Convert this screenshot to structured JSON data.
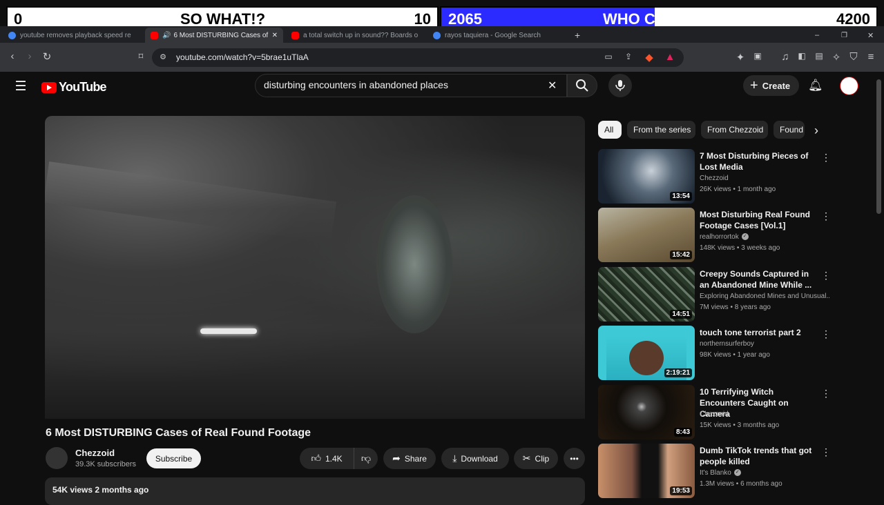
{
  "overlay": {
    "left_score": "0",
    "left_label": "SO WHAT!?",
    "left_count": "10",
    "right_score": "2065",
    "right_label": "WHO CARES!?",
    "right_count": "4200",
    "right_fill_fraction": 0.49,
    "accent": "#2b2bff"
  },
  "browser": {
    "tabs": [
      {
        "label": "youtube removes playback speed re",
        "favicon": "google-icon",
        "color": "#4285f4"
      },
      {
        "label": "6 Most DISTURBING Cases of",
        "favicon": "youtube-icon",
        "color": "#ff0000"
      },
      {
        "label": "a total switch up in sound?? Boards o",
        "favicon": "youtube-icon",
        "color": "#ff0000"
      },
      {
        "label": "rayos taquiera - Google Search",
        "favicon": "google-icon",
        "color": "#4285f4"
      }
    ],
    "url": "youtube.com/watch?v=5brae1uTlaA"
  },
  "youtube": {
    "logo": "YouTube",
    "search_value": "disturbing encounters in abandoned places",
    "create_label": "Create",
    "video_title": "6 Most DISTURBING Cases of Real Found Footage",
    "channel": "Chezzoid",
    "subscribers": "39.3K subscribers",
    "subscribe_label": "Subscribe",
    "likes": "1.4K",
    "share_label": "Share",
    "download_label": "Download",
    "clip_label": "Clip",
    "views_line": "54K views  2 months ago",
    "chips": [
      "All",
      "From the series",
      "From Chezzoid",
      "Found"
    ],
    "recommendations": [
      {
        "title": "7 Most Disturbing Pieces of Lost Media",
        "channel": "Chezzoid",
        "meta": "26K views • 1 month ago",
        "duration": "13:54",
        "verified": false,
        "thumb": "#4a5a6a"
      },
      {
        "title": "Most Disturbing Real Found Footage Cases [Vol.1]",
        "channel": "realhorrortok",
        "meta": "148K views • 3 weeks ago",
        "duration": "15:42",
        "verified": true,
        "thumb": "#7a6a4a"
      },
      {
        "title": "Creepy Sounds Captured in an Abandoned Mine While ...",
        "channel": "Exploring Abandoned Mines and Unusual...",
        "meta": "7M views • 8 years ago",
        "duration": "14:51",
        "verified": false,
        "thumb": "#3b4a3a"
      },
      {
        "title": "touch tone terrorist part 2",
        "channel": "northernsurferboy",
        "meta": "98K views • 1 year ago",
        "duration": "2:19:21",
        "verified": false,
        "thumb": "#3ec9d6"
      },
      {
        "title": "10 Terrifying Witch Encounters Caught on Camera",
        "channel": "Chezzoid",
        "meta": "15K views • 3 months ago",
        "duration": "8:43",
        "verified": false,
        "thumb": "#1a1510"
      },
      {
        "title": "Dumb TikTok trends that got people killed",
        "channel": "It's Blanko",
        "meta": "1.3M views • 6 months ago",
        "duration": "19:53",
        "verified": true,
        "thumb": "#a0704a"
      }
    ]
  }
}
